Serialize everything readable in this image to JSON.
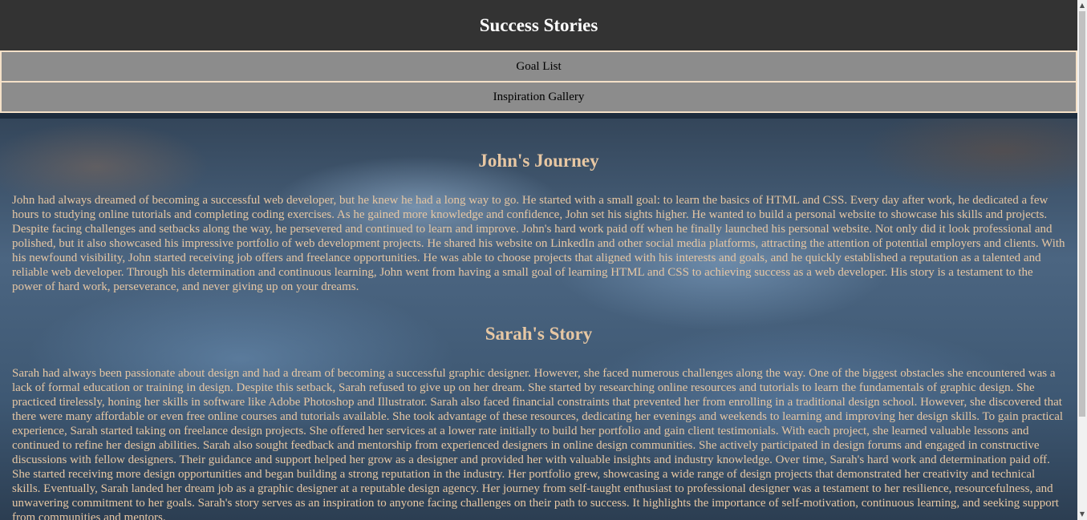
{
  "header": {
    "title": "Success Stories"
  },
  "nav": {
    "items": [
      {
        "label": "Goal List"
      },
      {
        "label": "Inspiration Gallery"
      }
    ]
  },
  "stories": [
    {
      "title": "John's Journey",
      "body": "John had always dreamed of becoming a successful web developer, but he knew he had a long way to go. He started with a small goal: to learn the basics of HTML and CSS. Every day after work, he dedicated a few hours to studying online tutorials and completing coding exercises. As he gained more knowledge and confidence, John set his sights higher. He wanted to build a personal website to showcase his skills and projects. Despite facing challenges and setbacks along the way, he persevered and continued to learn and improve. John's hard work paid off when he finally launched his personal website. Not only did it look professional and polished, but it also showcased his impressive portfolio of web development projects. He shared his website on LinkedIn and other social media platforms, attracting the attention of potential employers and clients. With his newfound visibility, John started receiving job offers and freelance opportunities. He was able to choose projects that aligned with his interests and goals, and he quickly established a reputation as a talented and reliable web developer. Through his determination and continuous learning, John went from having a small goal of learning HTML and CSS to achieving success as a web developer. His story is a testament to the power of hard work, perseverance, and never giving up on your dreams."
    },
    {
      "title": "Sarah's Story",
      "body": "Sarah had always been passionate about design and had a dream of becoming a successful graphic designer. However, she faced numerous challenges along the way. One of the biggest obstacles she encountered was a lack of formal education or training in design. Despite this setback, Sarah refused to give up on her dream. She started by researching online resources and tutorials to learn the fundamentals of graphic design. She practiced tirelessly, honing her skills in software like Adobe Photoshop and Illustrator. Sarah also faced financial constraints that prevented her from enrolling in a traditional design school. However, she discovered that there were many affordable or even free online courses and tutorials available. She took advantage of these resources, dedicating her evenings and weekends to learning and improving her design skills. To gain practical experience, Sarah started taking on freelance design projects. She offered her services at a lower rate initially to build her portfolio and gain client testimonials. With each project, she learned valuable lessons and continued to refine her design abilities. Sarah also sought feedback and mentorship from experienced designers in online design communities. She actively participated in design forums and engaged in constructive discussions with fellow designers. Their guidance and support helped her grow as a designer and provided her with valuable insights and industry knowledge. Over time, Sarah's hard work and determination paid off. She started receiving more design opportunities and began building a strong reputation in the industry. Her portfolio grew, showcasing a wide range of design projects that demonstrated her creativity and technical skills. Eventually, Sarah landed her dream job as a graphic designer at a reputable design agency. Her journey from self-taught enthusiast to professional designer was a testament to her resilience, resourcefulness, and unwavering commitment to her goals. Sarah's story serves as an inspiration to anyone facing challenges on their path to success. It highlights the importance of self-motivation, continuous learning, and seeking support from communities and mentors."
    }
  ],
  "colors": {
    "header_bg": "#333333",
    "nav_bg": "#8c8c8c",
    "nav_border": "#f5e1c8",
    "story_text": "#e7c7a3"
  },
  "icons": {
    "scroll_up": "scroll-up-arrow-icon",
    "scroll_down": "scroll-down-arrow-icon"
  }
}
